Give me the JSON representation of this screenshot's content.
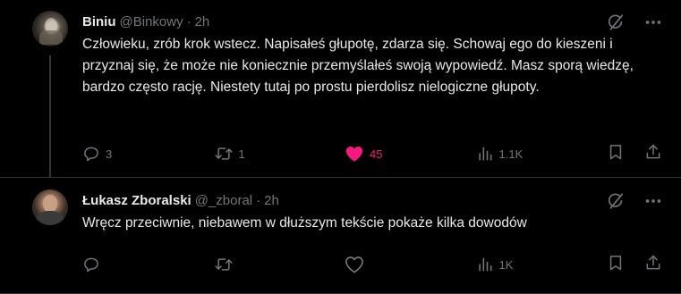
{
  "tweets": [
    {
      "author": {
        "name": "Biniu",
        "handle": "@Binkowy",
        "time": "2h",
        "separator": "·"
      },
      "text": "Człowieku, zrób krok wstecz. Napisałeś głupotę, zdarza się. Schowaj ego do kieszeni i przyznaj się, że może nie koniecznie przemyślałeś swoją wypowiedź. Masz sporą wiedzę, bardzo często rację. Niestety tutaj po prostu pierdolisz nielogiczne głupoty.",
      "stats": {
        "replies": "3",
        "reposts": "1",
        "likes": "45",
        "views": "1.1K"
      },
      "liked": true,
      "icons": {
        "grok": "grok-icon",
        "more": "more-icon"
      }
    },
    {
      "author": {
        "name": "Łukasz Zboralski",
        "handle": "@_zboral",
        "time": "2h",
        "separator": "·"
      },
      "text": "Wręcz przeciwnie, niebawem w dłuższym tekście pokaże kilka dowodów",
      "stats": {
        "replies": "",
        "reposts": "",
        "likes": "",
        "views": "1K"
      },
      "liked": false,
      "icons": {
        "grok": "grok-icon",
        "more": "more-icon"
      }
    }
  ],
  "colors": {
    "background": "#000000",
    "text": "#e7e9ea",
    "muted": "#71767b",
    "like": "#f91880",
    "divider": "#2f3336"
  }
}
